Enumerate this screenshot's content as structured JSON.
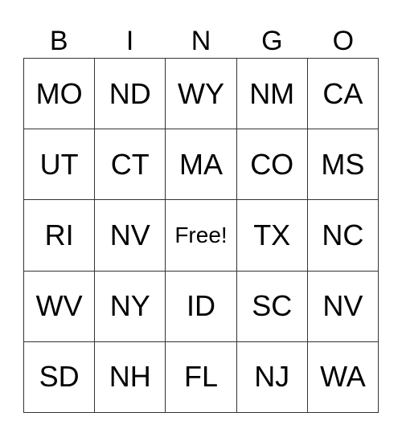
{
  "header": [
    "B",
    "I",
    "N",
    "G",
    "O"
  ],
  "cells": [
    [
      "MO",
      "ND",
      "WY",
      "NM",
      "CA"
    ],
    [
      "UT",
      "CT",
      "MA",
      "CO",
      "MS"
    ],
    [
      "RI",
      "NV",
      "Free!",
      "TX",
      "NC"
    ],
    [
      "WV",
      "NY",
      "ID",
      "SC",
      "NV"
    ],
    [
      "SD",
      "NH",
      "FL",
      "NJ",
      "WA"
    ]
  ]
}
